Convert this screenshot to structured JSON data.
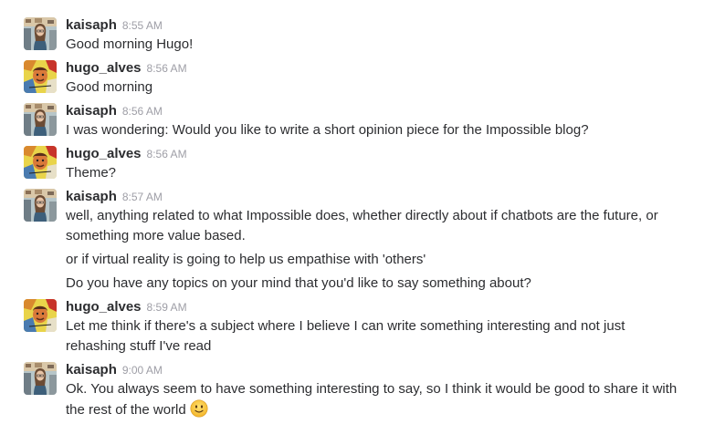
{
  "messages": [
    {
      "user": "kaisaph",
      "time": "8:55 AM",
      "avatar": "kaisaph-avatar",
      "lines": [
        "Good morning Hugo!"
      ]
    },
    {
      "user": "hugo_alves",
      "time": "8:56 AM",
      "avatar": "hugo-avatar",
      "lines": [
        "Good morning"
      ]
    },
    {
      "user": "kaisaph",
      "time": "8:56 AM",
      "avatar": "kaisaph-avatar",
      "lines": [
        "I was wondering: Would you like to write a short opinion piece for the Impossible blog?"
      ]
    },
    {
      "user": "hugo_alves",
      "time": "8:56 AM",
      "avatar": "hugo-avatar",
      "lines": [
        "Theme?"
      ]
    },
    {
      "user": "kaisaph",
      "time": "8:57 AM",
      "avatar": "kaisaph-avatar",
      "lines": [
        "well, anything related to what Impossible does, whether directly about if chatbots are the future, or",
        "something more value based.",
        "or if virtual reality is going to help us empathise with 'others'",
        "Do you have any topics on your mind that you'd like to say something about?"
      ]
    },
    {
      "user": "hugo_alves",
      "time": "8:59 AM",
      "avatar": "hugo-avatar",
      "lines": [
        "Let me think if there's a subject where I believe I can write something interesting and not just",
        "rehashing stuff I've read"
      ]
    },
    {
      "user": "kaisaph",
      "time": "9:00 AM",
      "avatar": "kaisaph-avatar",
      "lines": [
        "Ok. You always seem to have something interesting to say, so I think it would be good to share it with",
        "the rest of the world"
      ],
      "emoji": "slightly-smiling-face-icon"
    }
  ],
  "colors": {
    "text": "#2c2d30",
    "timestamp": "#9e9ea6",
    "background": "#ffffff"
  }
}
